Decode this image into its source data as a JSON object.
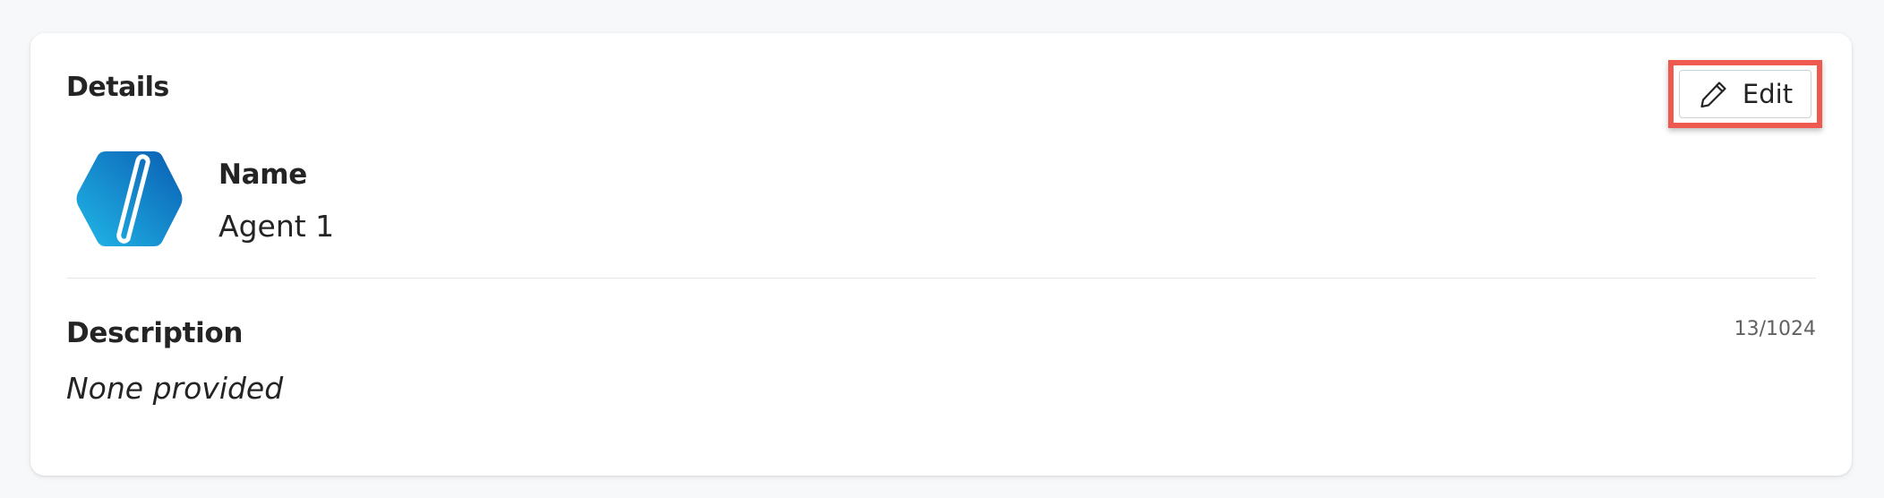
{
  "details": {
    "title": "Details",
    "edit_button_label": "Edit",
    "name_label": "Name",
    "name_value": "Agent 1",
    "description_label": "Description",
    "description_value": "None provided",
    "description_char_count": "13/1024"
  },
  "icons": {
    "edit": "pencil-icon",
    "avatar": "agent-logo"
  },
  "colors": {
    "highlight_border": "#ee5a4f",
    "avatar_gradient_start": "#1aa7e0",
    "avatar_gradient_end": "#0a5fb5"
  }
}
